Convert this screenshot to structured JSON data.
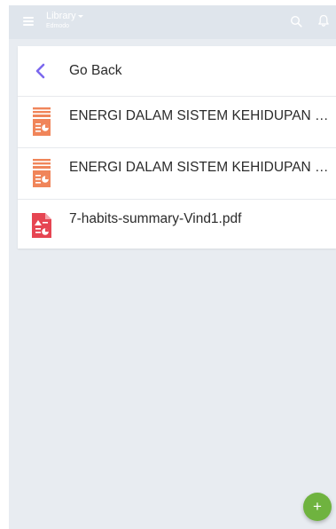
{
  "appbar": {
    "title": "Library",
    "subtitle": "Edmodo",
    "menu_icon": "hamburger-menu-icon",
    "search_icon": "search-icon",
    "notification_icon": "bell-icon"
  },
  "list": {
    "back_label": "Go Back",
    "items": [
      {
        "name": "ENERGI DALAM SISTEM KEHIDUPAN bag...",
        "icon": "presentation-file-icon",
        "icon_color": "#f0855a"
      },
      {
        "name": "ENERGI DALAM SISTEM KEHIDUPAN bag...",
        "icon": "presentation-file-icon",
        "icon_color": "#f0855a"
      },
      {
        "name": "7-habits-summary-Vind1.pdf",
        "icon": "pdf-file-icon",
        "icon_color": "#e64552"
      }
    ]
  },
  "fab": {
    "label": "+",
    "color": "#6fb33f"
  },
  "colors": {
    "background": "#e8ecf1",
    "appbar": "#dfe5ec",
    "accent": "#7b68ee"
  }
}
